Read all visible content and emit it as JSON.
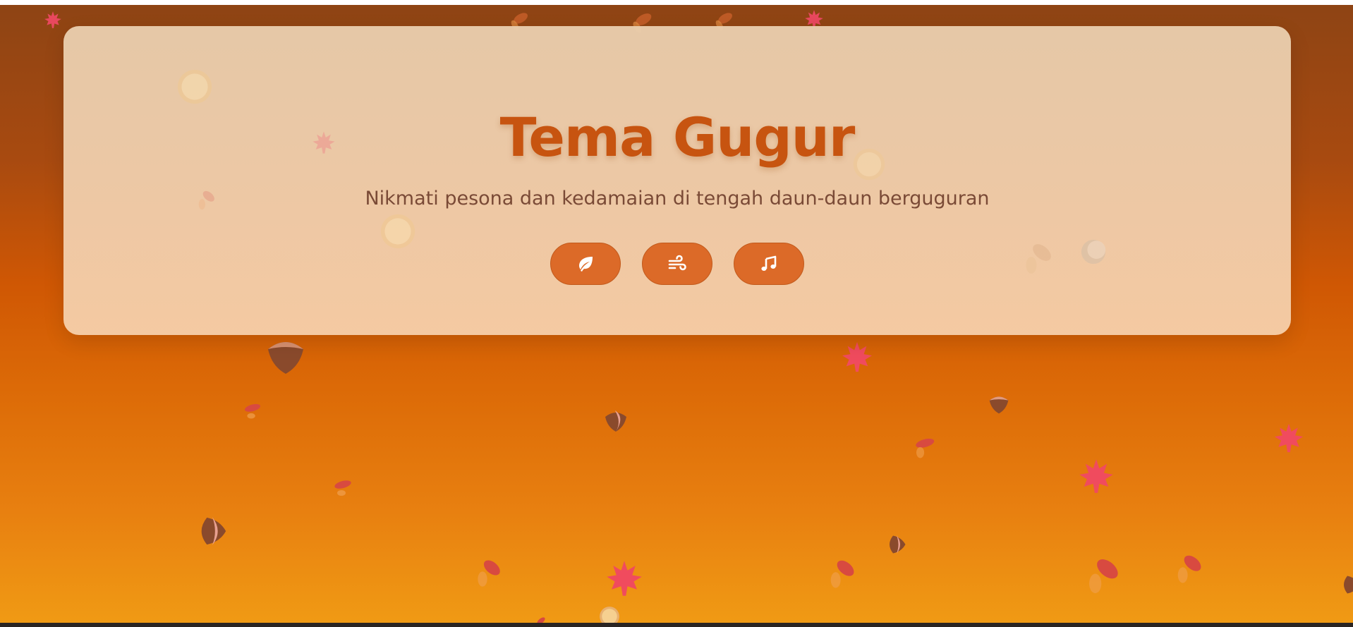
{
  "hero": {
    "title": "Tema Gugur",
    "subtitle": "Nikmati pesona dan kedamaian di tengah daun-daun berguguran"
  },
  "controls": [
    {
      "name": "leaf-button",
      "icon": "leaf-icon"
    },
    {
      "name": "wind-button",
      "icon": "wind-icon"
    },
    {
      "name": "music-button",
      "icon": "music-note-icon"
    }
  ],
  "colors": {
    "background_top": "#8e4414",
    "background_mid": "#cf5704",
    "background_bottom": "#f09a14",
    "title": "#c75410",
    "subtitle": "#7a4a36",
    "button": "#dc6a28",
    "maple": "#f04b5e",
    "chestnut": "#8a4a2c"
  }
}
